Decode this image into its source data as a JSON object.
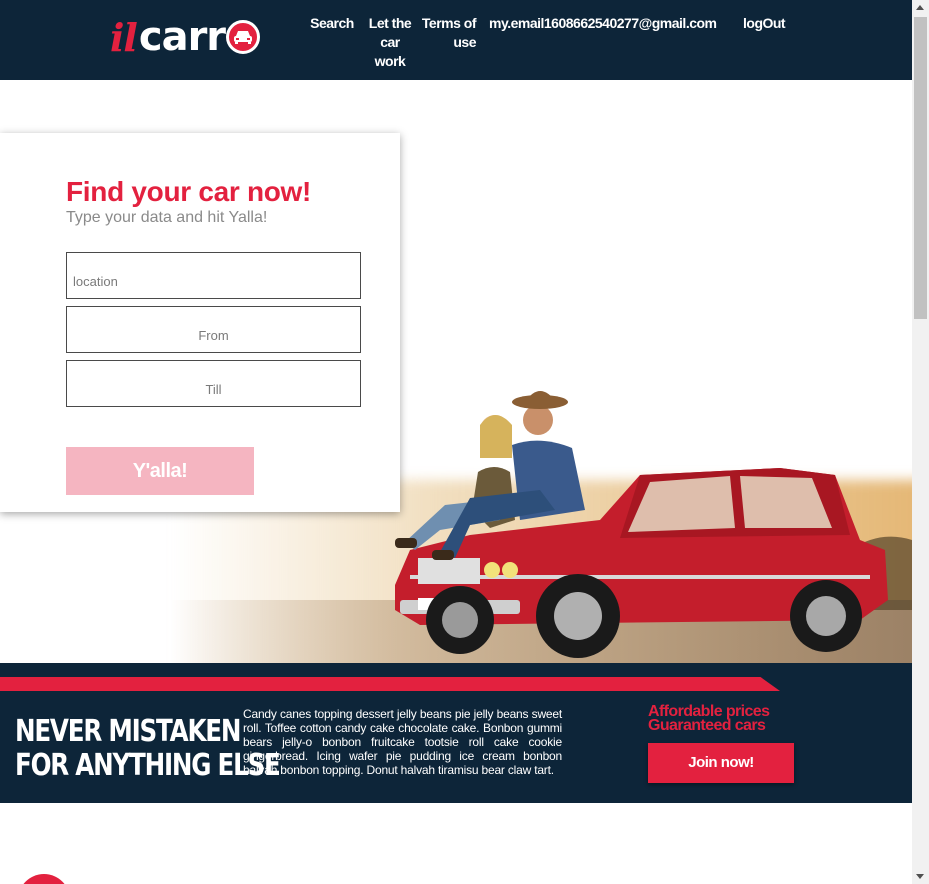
{
  "header": {
    "logo_il": "il",
    "logo_carr": "carr",
    "nav": {
      "search": "Search",
      "let_car_work": "Let the car work",
      "terms": "Terms of use",
      "email": "my.email1608662540277@gmail.com",
      "logout": "logOut"
    }
  },
  "search_card": {
    "title": "Find your car now!",
    "subtitle": "Type your data and hit Yalla!",
    "location_placeholder": "location",
    "from_placeholder": "From",
    "till_placeholder": "Till",
    "submit_label": "Y'alla!"
  },
  "banner": {
    "slogan_line1": "NEVER MISTAKEN",
    "slogan_line2": "FOR ANYTHING ELSE",
    "text": "Candy canes topping dessert jelly beans pie jelly beans sweet roll. Toffee cotton candy cake chocolate cake. Bonbon gummi bears jelly-o bonbon fruitcake tootsie roll cake cookie gingerbread. Icing wafer pie pudding ice cream bonbon halvah bonbon topping. Donut halvah tiramisu bear claw tart.",
    "promo_line1": "Affordable prices",
    "promo_line2": "Guaranteed cars",
    "join_label": "Join now!"
  },
  "colors": {
    "brand_red": "#e3213f",
    "navy": "#0d2539",
    "button_disabled": "#f5b5c1"
  }
}
